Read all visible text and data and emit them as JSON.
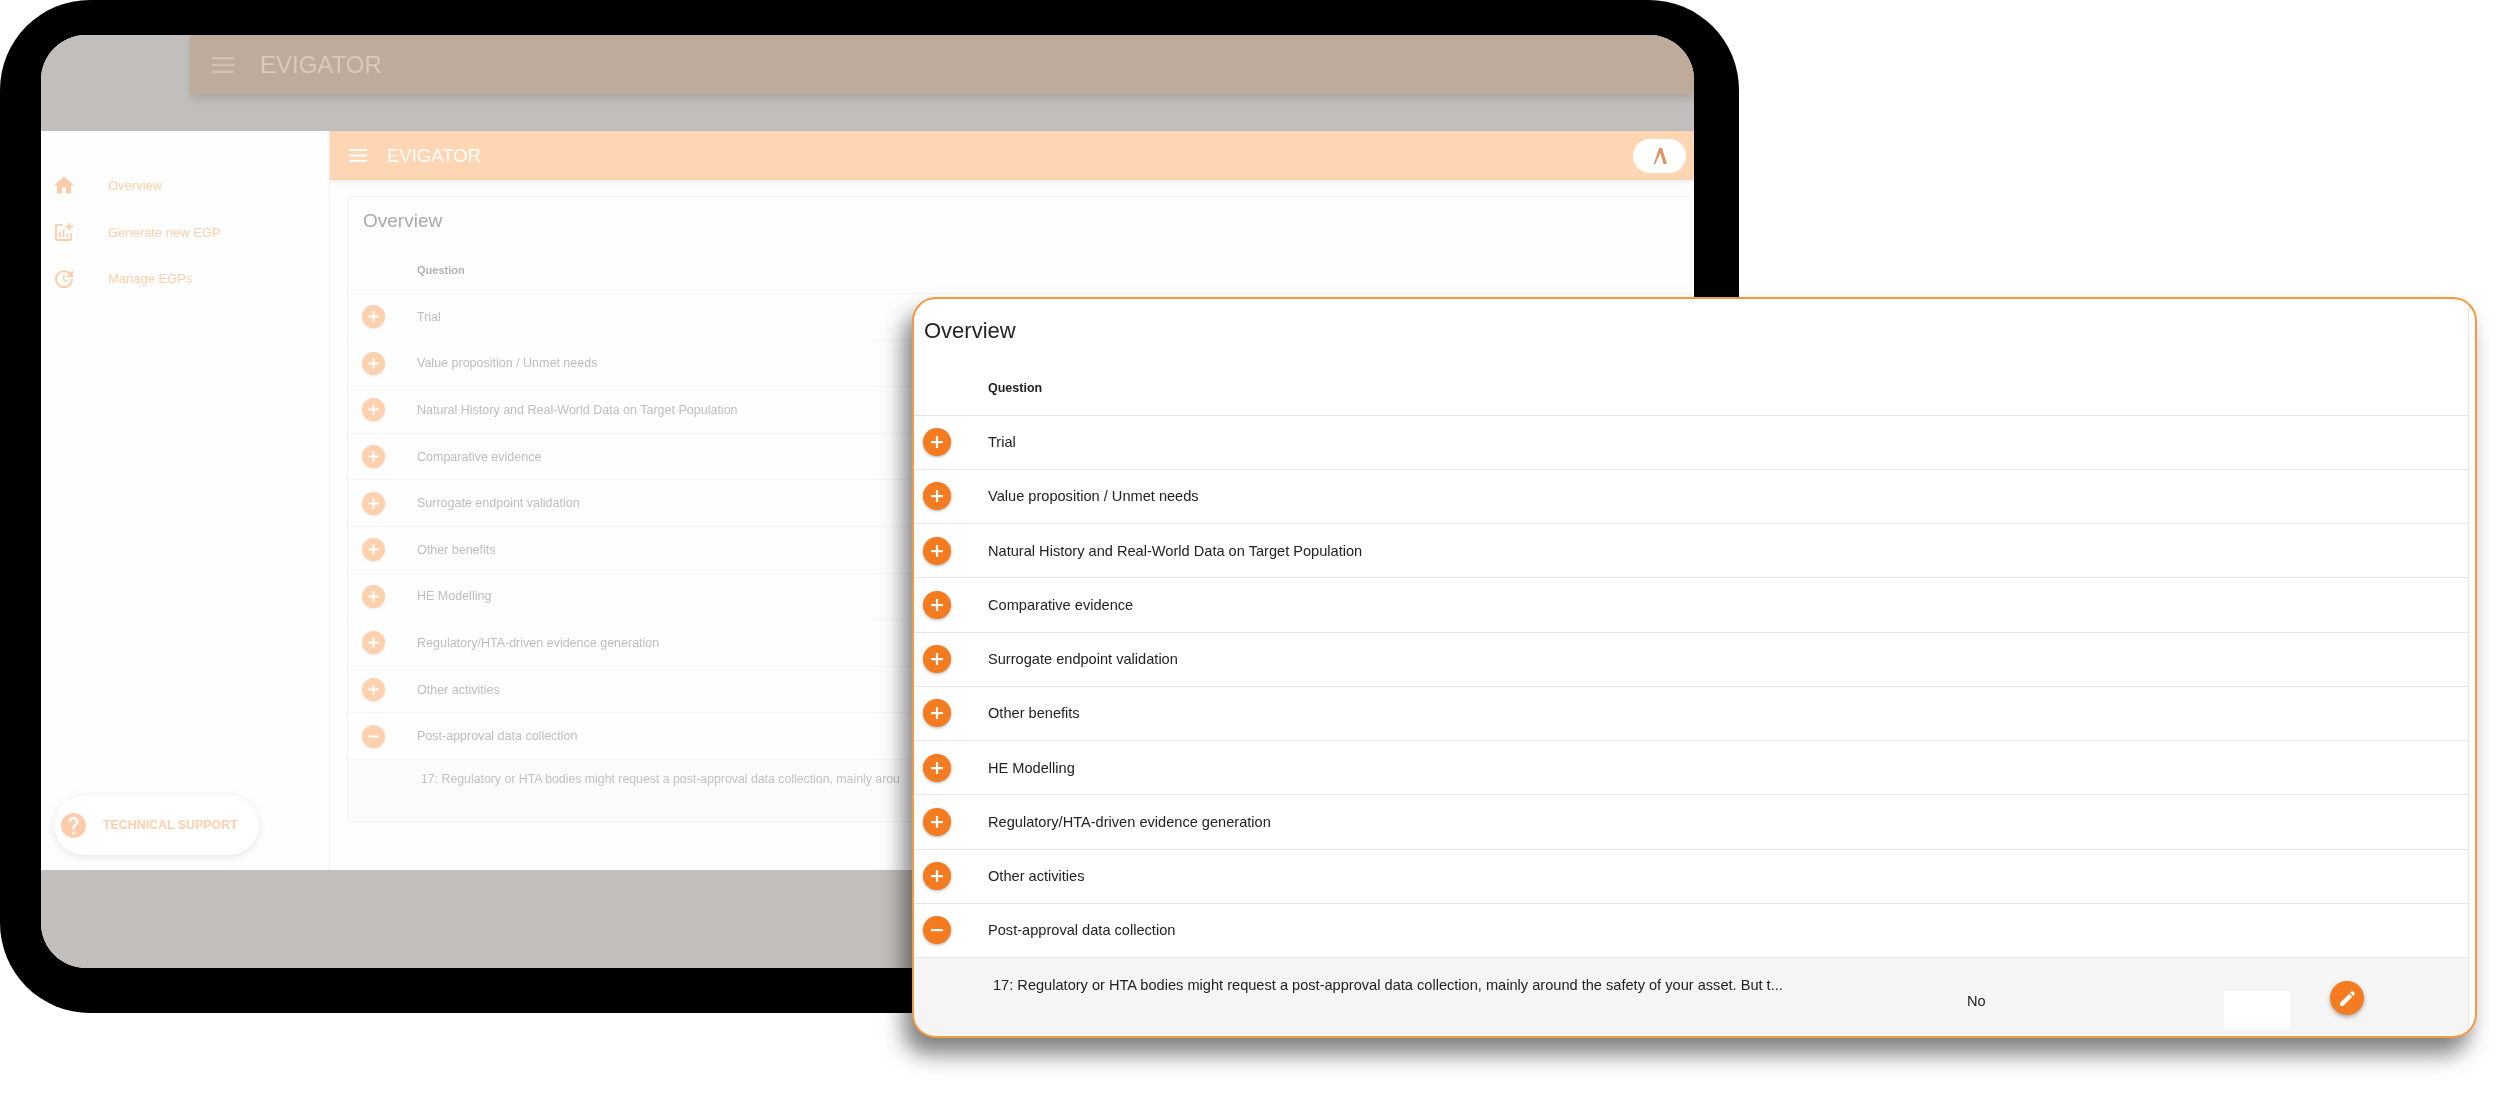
{
  "tablet_screen": {
    "blurred_header": {
      "title": "EVIGATOR"
    },
    "sidebar": {
      "items": [
        {
          "label": "Overview"
        },
        {
          "label": "Generate new EGP"
        },
        {
          "label": "Manage EGPs"
        }
      ],
      "support_button": {
        "label": "TECHNICAL SUPPORT"
      }
    },
    "app_bar": {
      "title": "EVIGATOR"
    },
    "overview_card": {
      "title": "Overview",
      "column_header": "Question",
      "rows": [
        {
          "question": "Trial",
          "expanded": false
        },
        {
          "question": "Value proposition / Unmet needs",
          "expanded": false
        },
        {
          "question": "Natural History and Real-World Data on Target Population",
          "expanded": false
        },
        {
          "question": "Comparative evidence",
          "expanded": false
        },
        {
          "question": "Surrogate endpoint validation",
          "expanded": false
        },
        {
          "question": "Other benefits",
          "expanded": false
        },
        {
          "question": "HE Modelling",
          "expanded": false
        },
        {
          "question": "Regulatory/HTA-driven evidence generation",
          "expanded": false
        },
        {
          "question": "Other activities",
          "expanded": false
        },
        {
          "question": "Post-approval data collection",
          "expanded": true,
          "details": [
            {
              "text": "17: Regulatory or HTA bodies might request a post-approval data collection, mainly arou"
            }
          ]
        }
      ]
    }
  },
  "overview_popup": {
    "title": "Overview",
    "column_header": "Question",
    "rows": [
      {
        "question": "Trial",
        "expanded": false
      },
      {
        "question": "Value proposition / Unmet needs",
        "expanded": false
      },
      {
        "question": "Natural History and Real-World Data on Target Population",
        "expanded": false
      },
      {
        "question": "Comparative evidence",
        "expanded": false
      },
      {
        "question": "Surrogate endpoint validation",
        "expanded": false
      },
      {
        "question": "Other benefits",
        "expanded": false
      },
      {
        "question": "HE Modelling",
        "expanded": false
      },
      {
        "question": "Regulatory/HTA-driven evidence generation",
        "expanded": false
      },
      {
        "question": "Other activities",
        "expanded": false
      },
      {
        "question": "Post-approval data collection",
        "expanded": true,
        "details": [
          {
            "text": "17: Regulatory or HTA bodies might request a post-approval data collection, mainly around the safety of your asset. But t...",
            "answer": "No"
          }
        ]
      }
    ]
  }
}
